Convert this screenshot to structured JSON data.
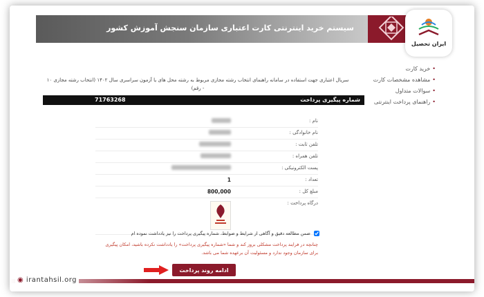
{
  "header": {
    "title": "سیستم خرید اینترنتی کارت اعتباری سازمان سنجش آموزش کشور"
  },
  "badge": {
    "text": "ایران تحصیل",
    "icon": "book-tree-logo-icon"
  },
  "sidebar": {
    "items": [
      {
        "label": "خرید کارت"
      },
      {
        "label": "مشاهده مشخصات کارت"
      },
      {
        "label": "سوالات متداول"
      },
      {
        "label": "راهنمای پرداخت اینترنتی"
      }
    ]
  },
  "notice": "سریال اعتباری جهت استفاده در سامانه راهنمای انتخاب رشته مجازی مربوط به رشته محل های یا آزمون سراسری سال ۱۴۰۲ (انتخاب رشته مجازی ۱۰ - رقم)",
  "tracking": {
    "label": "شماره پیگیری پرداخت",
    "value": "71763268"
  },
  "form": {
    "rows": [
      {
        "label": "نام :",
        "value": ""
      },
      {
        "label": "نام خانوادگی :",
        "value": ""
      },
      {
        "label": "تلفن ثابت :",
        "value": ""
      },
      {
        "label": "تلفن همراه :",
        "value": ""
      },
      {
        "label": "پست الکترونیکی :",
        "value": ""
      },
      {
        "label": "تعداد :",
        "value": "1"
      },
      {
        "label": "مبلغ کل :",
        "value": "800,000"
      }
    ],
    "gateway_label": "درگاه پرداخت :"
  },
  "agree": {
    "text": "ضمن مطالعه دقیق و آگاهی از شرایط و ضوابط، شماره پیگیری پرداخت را نیز یادداشت نموده ام",
    "checked": true
  },
  "warning": "چنانچه در فرایند پرداخت مشکلی بروز کند و شما «شماره پیگیری پرداخت» را یادداشت نکرده باشید، امکان پیگیری برای سازمان وجود ندارد و مسئولیت آن برعهده شما می باشد.",
  "submit": {
    "label": "ادامه روند پرداخت"
  },
  "site": {
    "url": "irantahsil.org"
  },
  "colors": {
    "brand": "#8b1a2b",
    "warning": "#c0392b"
  }
}
